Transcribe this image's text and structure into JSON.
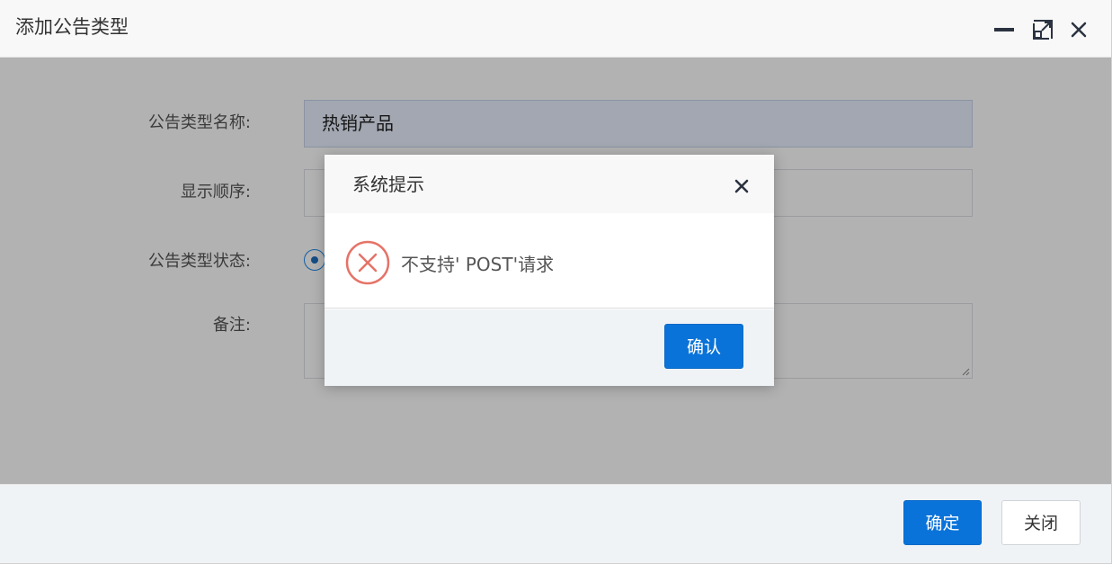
{
  "window": {
    "title": "添加公告类型"
  },
  "form": {
    "name_label": "公告类型名称:",
    "name_value": "热销产品",
    "order_label": "显示顺序:",
    "status_label": "公告类型状态:",
    "remark_label": "备注:"
  },
  "footer": {
    "ok_label": "确定",
    "close_label": "关闭"
  },
  "dialog": {
    "title": "系统提示",
    "message": "不支持' POST'请求",
    "confirm_label": "确认"
  },
  "colors": {
    "primary": "#0a73d9",
    "error": "#e57368"
  },
  "icons": {
    "minimize": "minimize-icon",
    "maximize": "maximize-icon",
    "close": "close-icon",
    "error": "error-circle-icon"
  }
}
